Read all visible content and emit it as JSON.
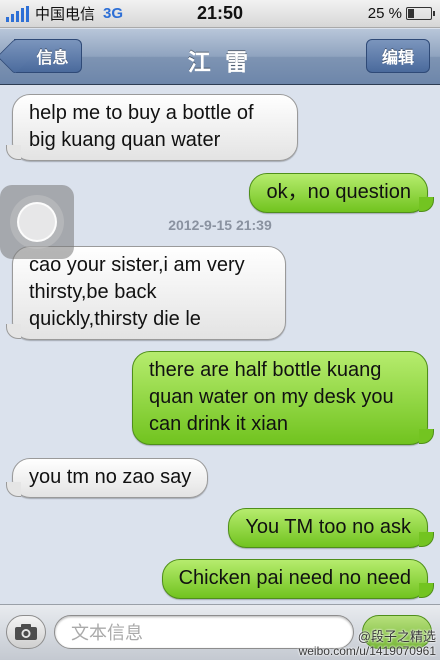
{
  "status_bar": {
    "carrier": "中国电信",
    "network": "3G",
    "time": "21:50",
    "battery_percent": "25 %",
    "battery_level": 0.25,
    "signal_icon": "signal-bars-icon",
    "battery_icon": "battery-icon"
  },
  "nav": {
    "back_label": "信息",
    "title": "江 雷",
    "edit_label": "编辑"
  },
  "messages": [
    {
      "direction": "in",
      "text": "help me to buy a bottle of big kuang quan water"
    },
    {
      "direction": "out",
      "text": "ok，no question"
    },
    {
      "direction": "in",
      "text": "cao your sister,i am very thirsty,be back quickly,thirsty die le"
    },
    {
      "direction": "out",
      "text": "there are half bottle kuang quan water on my desk you can drink it xian"
    },
    {
      "direction": "in",
      "text": "you tm no zao say"
    },
    {
      "direction": "out",
      "text": "You TM too no ask"
    },
    {
      "direction": "out",
      "text": "Chicken pai need no need"
    }
  ],
  "timestamp": "2012-9-15 21:39",
  "input_bar": {
    "placeholder": "文本信息",
    "camera_icon": "camera-icon"
  },
  "watermark": {
    "line1": "@段子之精选",
    "line2": "weibo.com/u/1419070961"
  },
  "colors": {
    "incoming_bubble": "#ffffff",
    "outgoing_bubble": "#8bd43a",
    "nav_bar": "#8fa3bf",
    "background": "#dbe2ed"
  }
}
